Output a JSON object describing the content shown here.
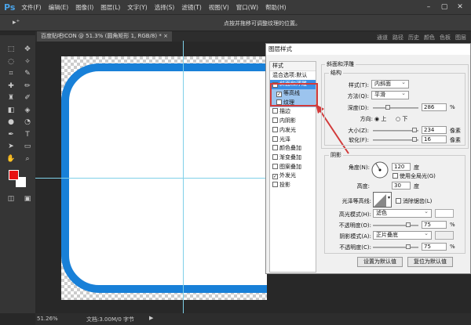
{
  "app": {
    "logo": "Ps",
    "menus": [
      "文件(F)",
      "编辑(E)",
      "图像(I)",
      "图层(L)",
      "文字(Y)",
      "选择(S)",
      "滤镜(T)",
      "视图(V)",
      "窗口(W)",
      "帮助(H)"
    ],
    "window_buttons": [
      "–",
      "▢",
      "✕"
    ]
  },
  "options_bar": {
    "hint": "点按并拖移可调整纹理的位置。"
  },
  "document": {
    "tab_title": "百度贴吧ICON @ 51.3% (圆角矩形 1, RGB/8) *",
    "close": "×"
  },
  "panel_tabs": [
    "通道",
    "路径",
    "历史",
    "颜色",
    "色板",
    "图层"
  ],
  "status": {
    "zoom": "51.26%",
    "doc_info": "文档:3.00M/0 字节"
  },
  "colors": {
    "foreground": "#e81010",
    "background": "#ffffff",
    "shape_stroke": "#1880d8",
    "highlight": "#d23a3a"
  },
  "dialog": {
    "title": "图层样式",
    "styles_header": "样式",
    "blend_options": "混合选项:默认",
    "items": [
      {
        "label": "斜面和浮雕",
        "checked": true,
        "selected": true
      },
      {
        "label": "等高线",
        "checked": true,
        "sub": true
      },
      {
        "label": "纹理",
        "checked": false,
        "sub": true
      },
      {
        "label": "描边",
        "checked": false
      },
      {
        "label": "内阴影",
        "checked": false
      },
      {
        "label": "内发光",
        "checked": false
      },
      {
        "label": "光泽",
        "checked": false
      },
      {
        "label": "颜色叠加",
        "checked": false
      },
      {
        "label": "渐变叠加",
        "checked": false
      },
      {
        "label": "图案叠加",
        "checked": false
      },
      {
        "label": "外发光",
        "checked": true
      },
      {
        "label": "投影",
        "checked": false
      }
    ],
    "bevel": {
      "group": "斜面和浮雕",
      "structure": "结构",
      "style_label": "样式(T):",
      "style_value": "内斜面",
      "technique_label": "方法(Q):",
      "technique_value": "平滑",
      "depth_label": "深度(D):",
      "depth_value": "286",
      "depth_unit": "%",
      "direction_label": "方向:",
      "dir_up": "上",
      "dir_down": "下",
      "size_label": "大小(Z):",
      "size_value": "234",
      "size_unit": "像素",
      "soften_label": "软化(F):",
      "soften_value": "16",
      "soften_unit": "像素"
    },
    "shading": {
      "group": "阴影",
      "angle_label": "角度(N):",
      "angle_value": "120",
      "angle_unit": "度",
      "global_light": "使用全局光(G)",
      "altitude_label": "高度:",
      "altitude_value": "30",
      "altitude_unit": "度",
      "gloss_label": "光泽等高线:",
      "antialias": "消除锯齿(L)",
      "highlight_mode_label": "高光模式(H):",
      "highlight_mode": "滤色",
      "opacity1_label": "不透明度(O):",
      "opacity1": "75",
      "shadow_mode_label": "阴影模式(A):",
      "shadow_mode": "正片叠底",
      "opacity2_label": "不透明度(C):",
      "opacity2": "75",
      "pct": "%"
    },
    "btn_default": "设置为默认值",
    "btn_reset": "复位为默认值"
  }
}
